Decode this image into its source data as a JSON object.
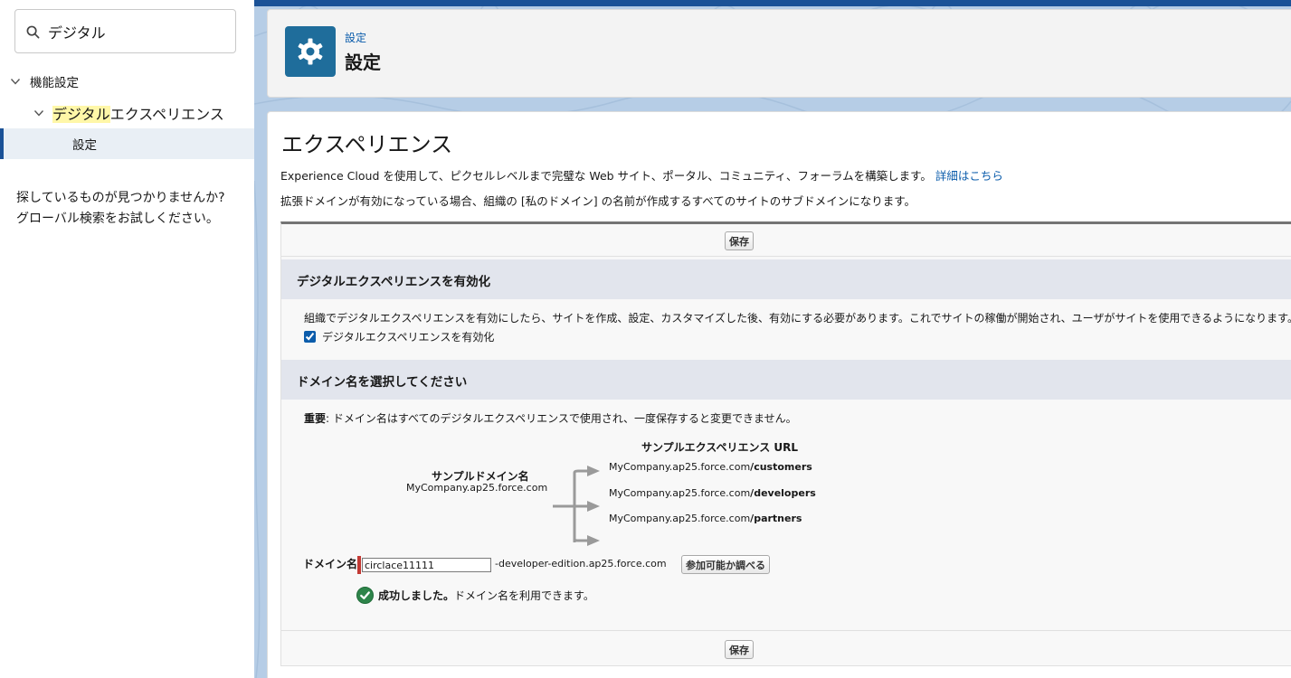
{
  "sidebar": {
    "search_value": "デジタル",
    "tree": {
      "level1": "機能設定",
      "level2_highlight": "デジタル",
      "level2_rest": "エクスペリエンス",
      "level3": "設定"
    },
    "not_found_line1": "探しているものが見つかりませんか?",
    "not_found_line2": "グローバル検索をお試しください。"
  },
  "header": {
    "breadcrumb": "設定",
    "title": "設定",
    "icon": "gear-icon"
  },
  "content": {
    "heading": "エクスペリエンス",
    "description1": "Experience Cloud を使用して、ピクセルレベルまで完璧な Web サイト、ポータル、コミュニティ、フォーラムを構築します。",
    "learn_more": "詳細はこちら",
    "description2": "拡張ドメインが有効になっている場合、組織の [私のドメイン] の名前が作成するすべてのサイトのサブドメインになります。",
    "save_label": "保存",
    "section1": {
      "title": "デジタルエクスペリエンスを有効化",
      "text": "組織でデジタルエクスペリエンスを有効にしたら、サイトを作成、設定、カスタマイズした後、有効にする必要があります。これでサイトの稼働が開始され、ユーザがサイトを使用できるようになります。",
      "checkbox_label": "デジタルエクスペリエンスを有効化",
      "checkbox_checked": true
    },
    "section2": {
      "title": "ドメイン名を選択してください",
      "important_label": "重要",
      "important_text": ": ドメイン名はすべてのデジタルエクスペリエンスで使用され、一度保存すると変更できません。",
      "sample_url_title": "サンプルエクスペリエンス URL",
      "sample_domain_title": "サンプルドメイン名",
      "sample_domain_value": "MyCompany.ap25.force.com",
      "url_prefix": "MyCompany.ap25.force.com",
      "url_paths": [
        "/customers",
        "/developers",
        "/partners"
      ],
      "domain_label": "ドメイン名",
      "domain_value": "circlace11111",
      "domain_suffix": "-developer-edition.ap25.force.com",
      "check_button": "参加可能か調べる",
      "success_bold": "成功しました。",
      "success_text": "ドメイン名を利用できます。"
    }
  },
  "colors": {
    "accent": "#0b5cab",
    "header_icon_bg": "#1f6d9b",
    "required_bar": "#c23934",
    "success": "#2e844a"
  }
}
